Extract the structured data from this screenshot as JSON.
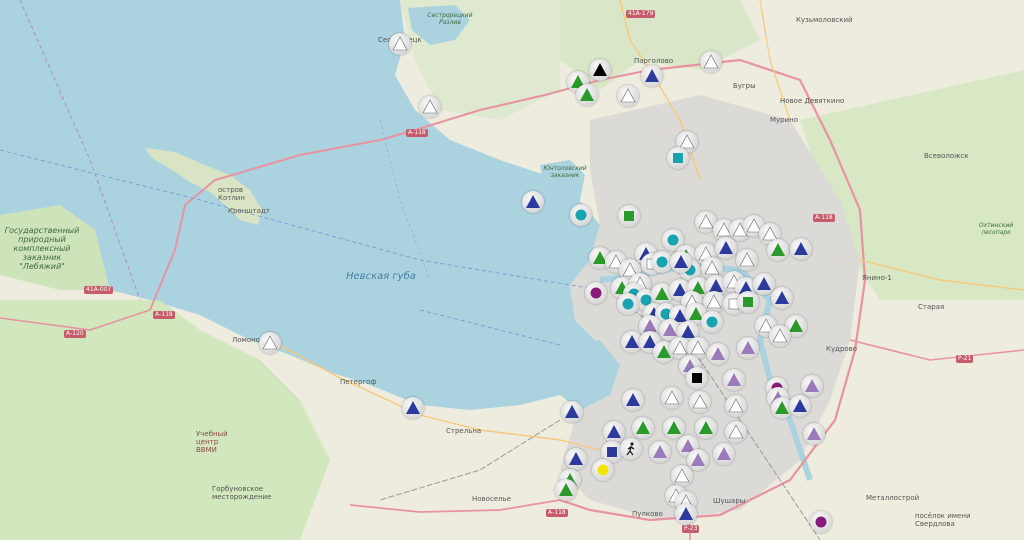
{
  "labels": {
    "bay": "Невская губа",
    "kotlin_island": "остров Котлин",
    "kronshtadt": "Кронштадт",
    "lebyazhy": "Государственный природный комплексный заказник \"Лебяжий\"",
    "lomonosov": "Ломоносов",
    "peterhof": "Петергоф",
    "strelna": "Стрельна",
    "novoselye": "Новоселье",
    "pargolovo": "Парголово",
    "murino": "Мурино",
    "novoe_devyatkino": "Новое Девяткино",
    "bugry": "Бугры",
    "kuzmolovsky": "Кузьмоловский",
    "vsevolozhsk": "Всеволожск",
    "yanino": "Янино-1",
    "staraya": "Старая",
    "kudrovo": "Кудрово",
    "metallostroy": "Металлострой",
    "shushary": "Шушары",
    "sestroretsk": "Сестрорецк",
    "sestroretsky_razliv": "Сестрорецкий Разлив",
    "yuntolovsky": "Юнтоловский заказник",
    "okhta_park": "Охтинский лесопарк",
    "pulkovo": "Пулково",
    "poselok_sverdlova": "посёлок имени Свердлова",
    "uchebny_center": "Учебный центр ВВМИ",
    "gorelovskoe": "Горбуновское месторождение"
  },
  "roads": {
    "a118_north": "А-118",
    "a118_ne": "А-118",
    "a118_sw": "А-118",
    "a118_south": "А-118",
    "a120": "А-120",
    "r21": "Р-21",
    "r23": "Р-23",
    "n41a179": "41А-179",
    "n41a007": "41А-007"
  },
  "colors": {
    "water": "#aad3df",
    "land": "#f2efe9",
    "green": "#cde6b7",
    "urban": "#d9d9d9",
    "road_primary": "#e892a2",
    "marker_navy": "#2b3a9c",
    "marker_green": "#2a9a2a",
    "marker_teal": "#18a3b0",
    "marker_purple": "#9a7ab8",
    "marker_magenta": "#8a1a7a",
    "marker_white": "#ffffff",
    "marker_black": "#000000",
    "marker_yellow": "#f2e600"
  }
}
